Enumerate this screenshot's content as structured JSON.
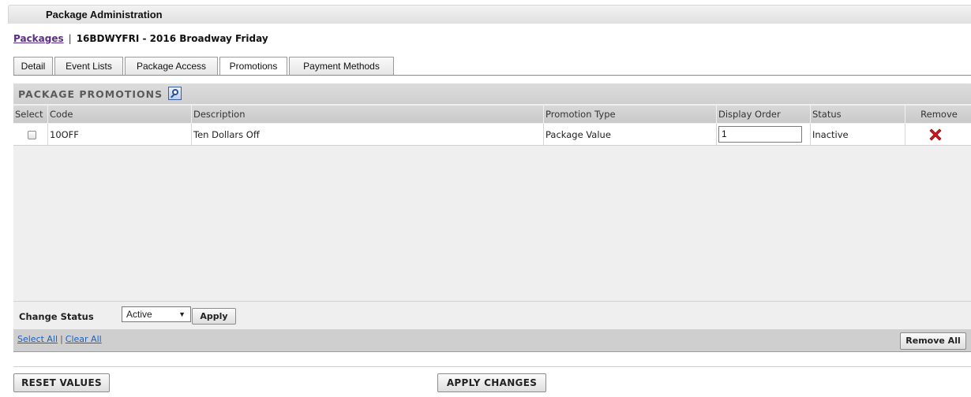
{
  "header": {
    "title": "Package Administration"
  },
  "breadcrumb": {
    "link": "Packages",
    "separator": "|",
    "current": "16BDWYFRI - 2016 Broadway Friday"
  },
  "tabs": [
    {
      "label": "Detail",
      "active": false
    },
    {
      "label": "Event Lists",
      "active": false
    },
    {
      "label": "Package Access",
      "active": false
    },
    {
      "label": "Promotions",
      "active": true
    },
    {
      "label": "Payment Methods",
      "active": false
    }
  ],
  "panel": {
    "title": "PACKAGE PROMOTIONS",
    "search_icon": "magnifier-icon"
  },
  "table": {
    "columns": [
      "Select",
      "Code",
      "Description",
      "Promotion Type",
      "Display Order",
      "Status",
      "Remove"
    ],
    "rows": [
      {
        "selected": false,
        "code": "10OFF",
        "description": "Ten Dollars Off",
        "promotion_type": "Package Value",
        "display_order": "1",
        "status": "Inactive",
        "remove_icon": "red-x-icon"
      }
    ]
  },
  "change_status": {
    "label": "Change Status",
    "selected": "Active",
    "apply_label": "Apply"
  },
  "selection": {
    "select_all": "Select All",
    "separator": "|",
    "clear_all": "Clear All",
    "remove_all": "Remove All"
  },
  "actions": {
    "reset": "RESET VALUES",
    "apply_changes": "APPLY CHANGES"
  },
  "colors": {
    "link": "#5a2d82",
    "accent_link": "#1d5fbf",
    "remove": "#d0191f",
    "panel_bg": "#efefef"
  }
}
